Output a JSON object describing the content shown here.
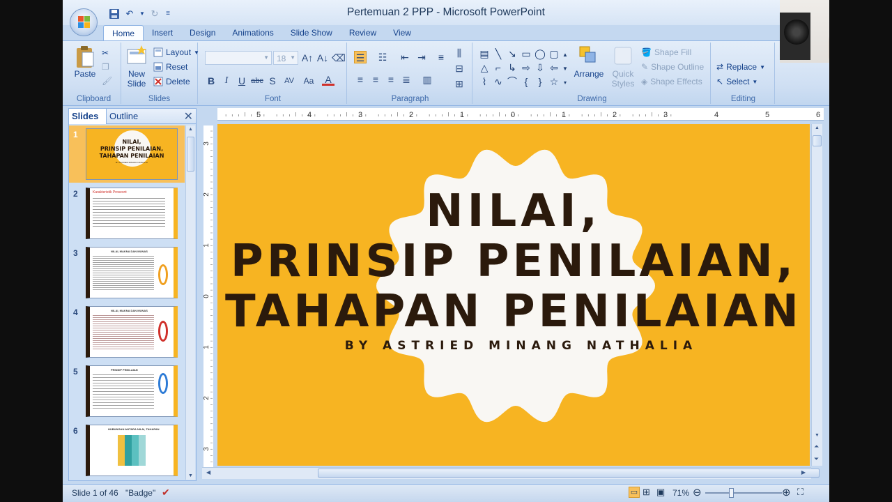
{
  "window": {
    "title": "Pertemuan 2 PPP - Microsoft PowerPoint"
  },
  "tabs": [
    {
      "label": "Home",
      "active": true
    },
    {
      "label": "Insert"
    },
    {
      "label": "Design"
    },
    {
      "label": "Animations"
    },
    {
      "label": "Slide Show"
    },
    {
      "label": "Review"
    },
    {
      "label": "View"
    }
  ],
  "ribbon": {
    "clipboard": {
      "label": "Clipboard",
      "paste": "Paste"
    },
    "slides": {
      "label": "Slides",
      "new_slide_1": "New",
      "new_slide_2": "Slide",
      "layout": "Layout",
      "reset": "Reset",
      "delete": "Delete"
    },
    "font": {
      "label": "Font",
      "size": "18",
      "bold": "B",
      "italic": "I",
      "underline": "U",
      "strike": "abc",
      "shadow": "S",
      "spacing": "AV",
      "case": "Aa",
      "color": "A"
    },
    "paragraph": {
      "label": "Paragraph"
    },
    "drawing": {
      "label": "Drawing",
      "arrange": "Arrange",
      "quick_styles_1": "Quick",
      "quick_styles_2": "Styles",
      "shape_fill": "Shape Fill",
      "shape_outline": "Shape Outline",
      "shape_effects": "Shape Effects"
    },
    "editing": {
      "label": "Editing",
      "replace": "Replace",
      "select": "Select"
    }
  },
  "pane": {
    "tab_slides": "Slides",
    "tab_outline": "Outline",
    "close": "✕",
    "thumbnails": [
      {
        "num": "1",
        "selected": true
      },
      {
        "num": "2"
      },
      {
        "num": "3"
      },
      {
        "num": "4"
      },
      {
        "num": "5"
      },
      {
        "num": "6"
      }
    ]
  },
  "ruler": {
    "h_labels": [
      "5",
      "4",
      "3",
      "2",
      "1",
      "0",
      "1",
      "2",
      "3",
      "4",
      "5",
      "6"
    ],
    "v_labels": [
      "3",
      "2",
      "1",
      "0",
      "1",
      "2",
      "3"
    ]
  },
  "slide": {
    "line1": "NILAI,",
    "line2": "PRINSIP PENILAIAN,",
    "line3": "TAHAPAN PENILAIAN",
    "byline": "BY ASTRIED MINANG NATHALIA",
    "thumb_line1": "NILAI,",
    "thumb_line2": "PRINSIP PENILAIAN,",
    "thumb_line3": "TAHAPAN PENILAIAN",
    "thumb_by": "BY ASTRIED MINANG NATHALIA",
    "thumb2_title": "Karakteristik Prosesnt",
    "thumb3_title": "NILAI, MAKNA DAN MUNAS",
    "thumb4_title": "NILAI, MAKNA DAN MUNAS",
    "thumb5_title": "PRINSIP PENILAIAN",
    "thumb6_title": "HUBUNGAN ANTARA NILAI, TAHAPAN"
  },
  "status": {
    "slide_of": "Slide 1 of 46",
    "theme": "\"Badge\"",
    "zoom": "71%"
  },
  "colors": {
    "slide_bg": "#f7b422",
    "badge": "#f9f7f3",
    "title_text": "#2b1a0c",
    "ribbon_text": "#15428b"
  }
}
